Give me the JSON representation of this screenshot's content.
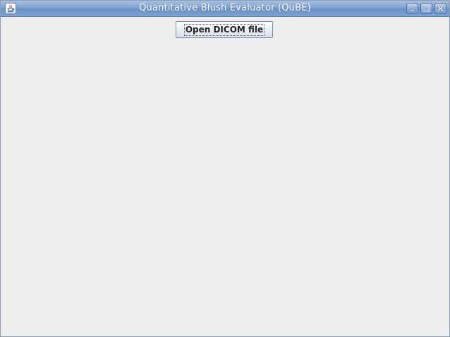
{
  "window": {
    "title": "Quantitative Blush Evaluator (QuBE)",
    "icon": "java-cup-icon",
    "controls": [
      "minimize-icon",
      "maximize-icon",
      "close-icon"
    ]
  },
  "main": {
    "open_button_label": "Open DICOM file"
  }
}
